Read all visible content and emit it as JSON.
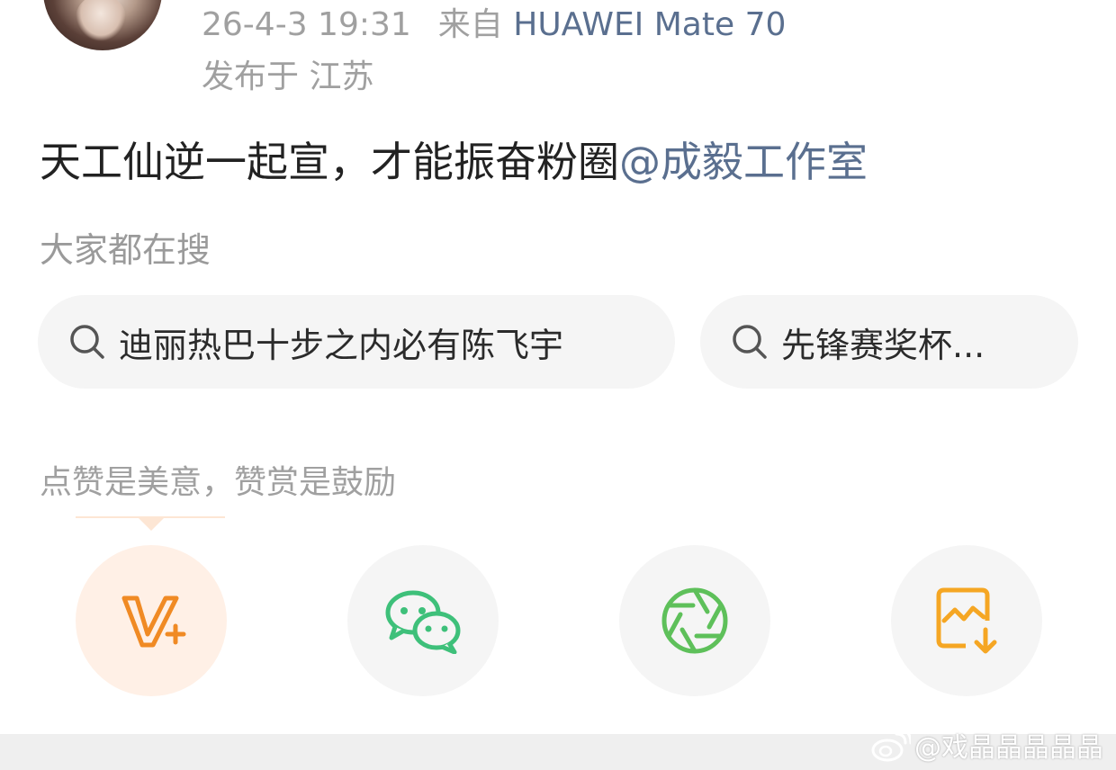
{
  "post": {
    "timestamp": "26-4-3 19:31",
    "source_prefix": "来自",
    "device": "HUAWEI Mate 70",
    "location": "发布于 江苏",
    "text": "天工仙逆一起宣，才能振奋粉圈",
    "mention": "@成毅工作室"
  },
  "search": {
    "heading": "大家都在搜",
    "chips": [
      {
        "label": "迪丽热巴十步之内必有陈飞宇",
        "icon": "search-icon"
      },
      {
        "label": "先锋赛奖杯...",
        "icon": "search-icon"
      }
    ]
  },
  "reward": {
    "tip": "点赞是美意，赞赏是鼓励"
  },
  "share": {
    "buttons": [
      {
        "icon": "v-plus-icon",
        "color": "#f08a24"
      },
      {
        "icon": "wechat-icon",
        "color": "#3ec07a"
      },
      {
        "icon": "moments-icon",
        "color": "#5ec05a"
      },
      {
        "icon": "save-image-icon",
        "color": "#f5a623"
      }
    ]
  },
  "watermark": {
    "text": "@戏晶晶晶晶晶",
    "icon": "weibo-logo-icon"
  }
}
